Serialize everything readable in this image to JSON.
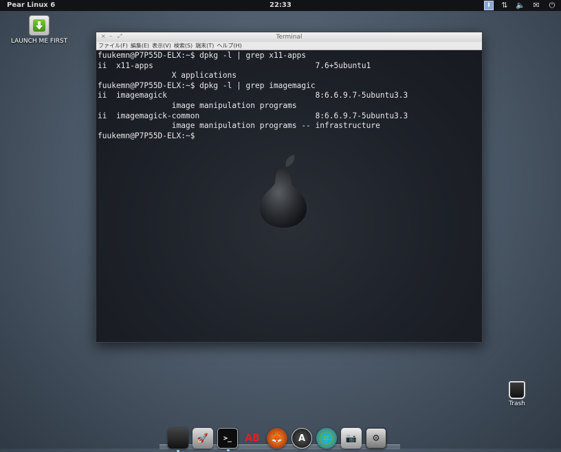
{
  "panel": {
    "app_name": "Pear Linux 6",
    "clock": "22:33",
    "tray_icons": [
      "ime-icon",
      "network-icon",
      "volume-icon",
      "mail-icon",
      "power-icon"
    ],
    "ime_label": "I"
  },
  "desktop": {
    "launcher_label": "LAUNCH ME FIRST",
    "trash_label": "Trash"
  },
  "terminal": {
    "title": "Terminal",
    "controls": [
      "×",
      "–",
      "⤢"
    ],
    "menu": [
      "ファイル(F)",
      "編集(E)",
      "表示(V)",
      "検索(S)",
      "端末(T)",
      "ヘルプ(H)"
    ],
    "lines": [
      "fuukemn@P7P55D-ELX:~$ dpkg -l | grep x11-apps",
      "ii  x11-apps                                   7.6+5ubuntu1",
      "                X applications",
      "fuukemn@P7P55D-ELX:~$ dpkg -l | grep imagemagic",
      "ii  imagemagick                                8:6.6.9.7-5ubuntu3.3",
      "                image manipulation programs",
      "ii  imagemagick-common                         8:6.6.9.7-5ubuntu3.3",
      "                image manipulation programs -- infrastructure",
      "fuukemn@P7P55D-ELX:~$"
    ]
  },
  "dock": {
    "items": [
      {
        "name": "desktop-icon",
        "glyph": ""
      },
      {
        "name": "rocket-icon",
        "glyph": "🚀"
      },
      {
        "name": "terminal-icon",
        "glyph": ">_"
      },
      {
        "name": "font-icon",
        "glyph": "AB"
      },
      {
        "name": "firefox-icon",
        "glyph": "🦊"
      },
      {
        "name": "app-store-icon",
        "glyph": "A"
      },
      {
        "name": "globe-icon",
        "glyph": "🌐"
      },
      {
        "name": "camera-icon",
        "glyph": "📷"
      },
      {
        "name": "settings-icon",
        "glyph": "⚙"
      }
    ]
  },
  "colors": {
    "panel_bg": "#121316",
    "terminal_bg": "#1b1f25",
    "terminal_text": "#e8e8e8"
  }
}
